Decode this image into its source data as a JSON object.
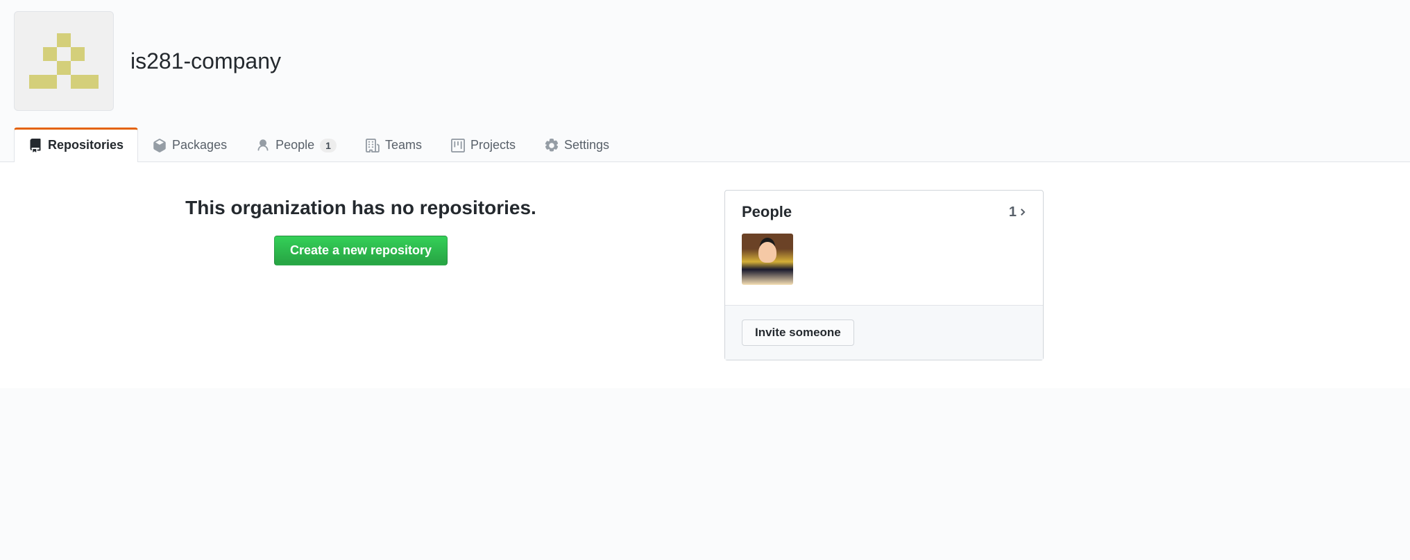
{
  "org": {
    "name": "is281-company"
  },
  "tabs": {
    "repositories": {
      "label": "Repositories",
      "active": true
    },
    "packages": {
      "label": "Packages"
    },
    "people": {
      "label": "People",
      "count": "1"
    },
    "teams": {
      "label": "Teams"
    },
    "projects": {
      "label": "Projects"
    },
    "settings": {
      "label": "Settings"
    }
  },
  "main": {
    "empty_title": "This organization has no repositories.",
    "create_button": "Create a new repository"
  },
  "sidebar": {
    "people": {
      "title": "People",
      "count": "1",
      "invite_button": "Invite someone"
    }
  }
}
